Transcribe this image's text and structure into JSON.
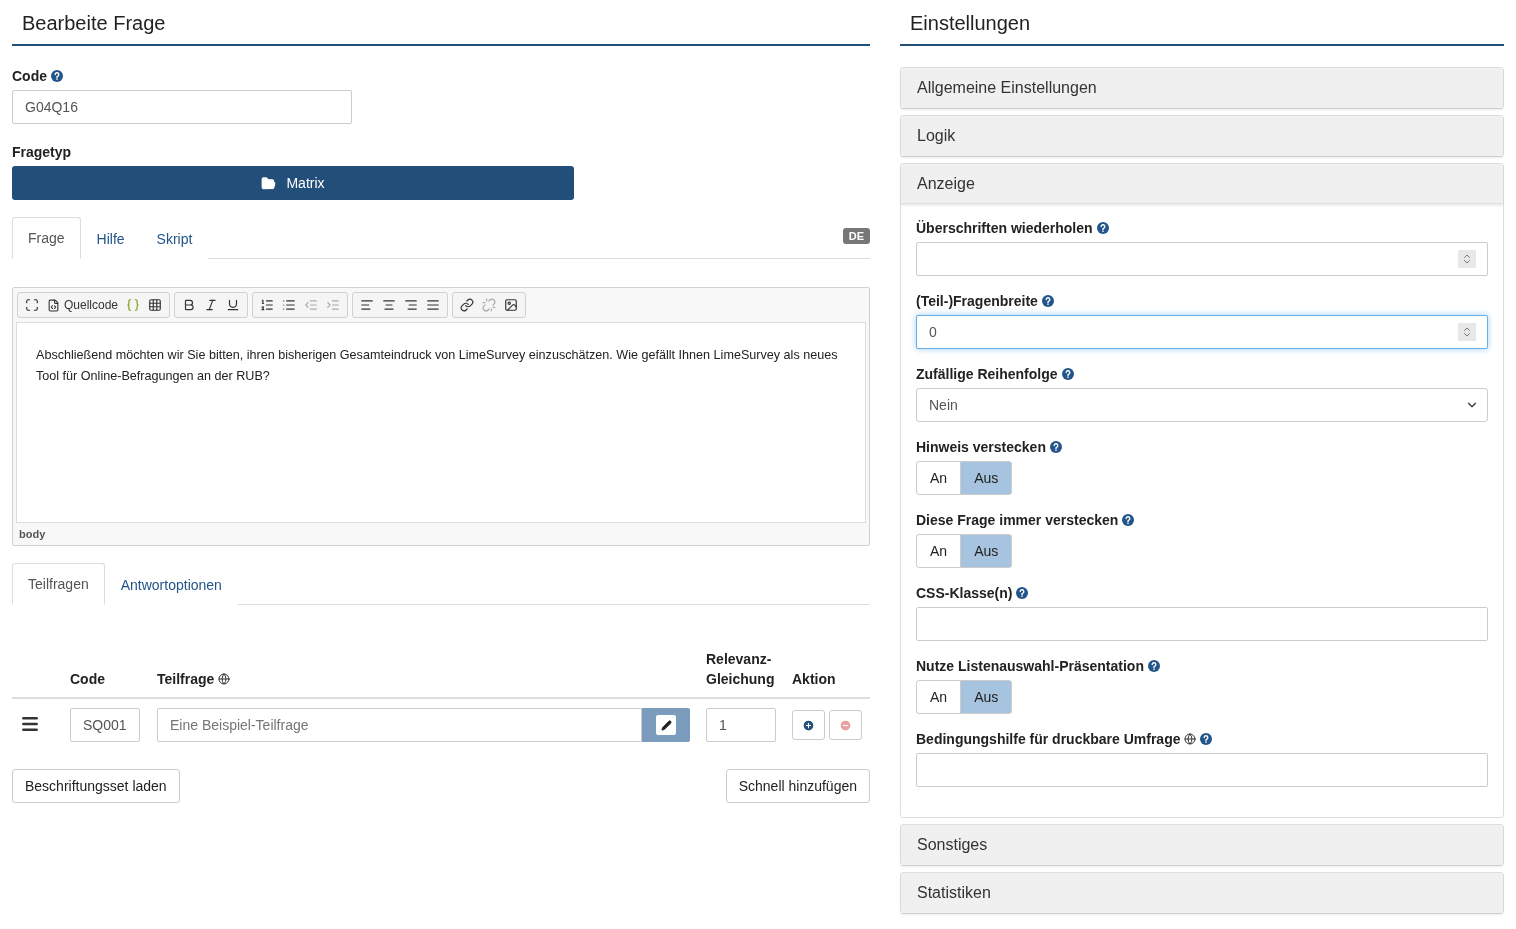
{
  "editor": {
    "title": "Bearbeite Frage",
    "code": {
      "label": "Code",
      "value": "G04Q16"
    },
    "question_type": {
      "label": "Fragetyp",
      "button": "Matrix"
    },
    "tabs": [
      {
        "label": "Frage",
        "selected": true
      },
      {
        "label": "Hilfe",
        "selected": false
      },
      {
        "label": "Skript",
        "selected": false
      }
    ],
    "language_badge": "DE",
    "toolbar": {
      "source_label": "Quellcode"
    },
    "text": "Abschließend möchten wir Sie bitten, ihren bisherigen Gesamteindruck von LimeSurvey einzuschätzen. Wie gefällt Ihnen LimeSurvey als neues Tool für Online-Befragungen an der RUB?",
    "path": "body",
    "subtabs": [
      {
        "label": "Teilfragen",
        "selected": true
      },
      {
        "label": "Antwortoptionen",
        "selected": false
      }
    ],
    "table": {
      "columns": [
        "Code",
        "Teilfrage",
        "Relevanz-Gleichung",
        "Aktion"
      ],
      "rows": [
        {
          "code": "SQ001",
          "placeholder": "Eine Beispiel-Teilfrage",
          "relevance": "1"
        }
      ]
    },
    "buttons": [
      "Beschriftungsset laden",
      "Schnell hinzufügen"
    ]
  },
  "settings": {
    "title": "Einstellungen",
    "sections": [
      {
        "title": "Allgemeine Einstellungen",
        "expanded": false
      },
      {
        "title": "Logik",
        "expanded": false
      },
      {
        "title": "Anzeige",
        "expanded": true,
        "fields": [
          {
            "kind": "number",
            "label": "Überschriften wiederholen",
            "focused": false
          },
          {
            "kind": "number",
            "label": "(Teil-)Fragenbreite",
            "value": "0",
            "focused": true
          },
          {
            "kind": "select",
            "label": "Zufällige Reihenfolge",
            "value": "Nein"
          },
          {
            "kind": "toggle",
            "label": "Hinweis verstecken",
            "options": [
              {
                "label": "An",
                "selected": false
              },
              {
                "label": "Aus",
                "selected": true
              }
            ]
          },
          {
            "kind": "toggle",
            "label": "Diese Frage immer verstecken",
            "options": [
              {
                "label": "An",
                "selected": false
              },
              {
                "label": "Aus",
                "selected": true
              }
            ]
          },
          {
            "kind": "text",
            "label": "CSS-Klasse(n)",
            "globe": false
          },
          {
            "kind": "toggle",
            "label": "Nutze Listenauswahl-Präsentation",
            "options": [
              {
                "label": "An",
                "selected": false
              },
              {
                "label": "Aus",
                "selected": true
              }
            ]
          },
          {
            "kind": "text",
            "label": "Bedingungshilfe für druckbare Umfrage",
            "globe": true
          }
        ]
      },
      {
        "title": "Sonstiges",
        "expanded": false
      },
      {
        "title": "Statistiken",
        "expanded": false
      }
    ]
  }
}
